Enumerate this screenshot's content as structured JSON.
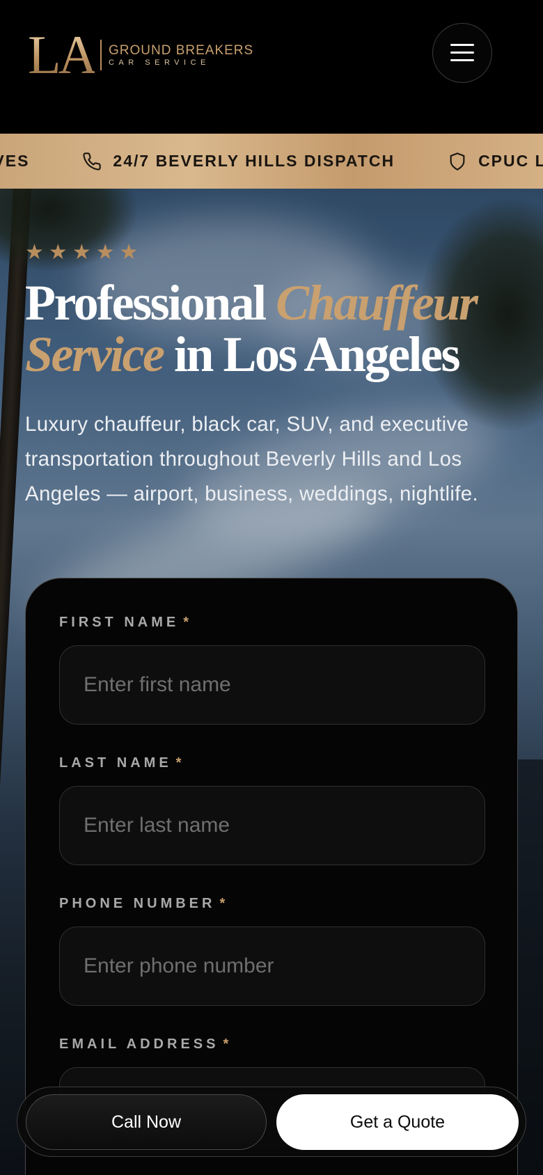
{
  "header": {
    "logo": {
      "mark": "LA",
      "line1": "GROUND BREAKERS",
      "line2": "CAR SERVICE"
    },
    "menu_icon": "hamburger-menu-icon"
  },
  "ticker": {
    "items": [
      {
        "icon": "",
        "label": "IVES"
      },
      {
        "icon": "phone-icon",
        "label": "24/7 BEVERLY HILLS DISPATCH"
      },
      {
        "icon": "shield-icon",
        "label": "CPUC L"
      }
    ]
  },
  "hero": {
    "rating_stars": 5,
    "headline": {
      "part1": "Professional ",
      "accent1": "Chauffeur",
      "accent2": "Service",
      "part2": " in Los Angeles"
    },
    "subtext": "Luxury chauffeur, black car, SUV, and executive transportation throughout Beverly Hills and Los Angeles — airport, business, weddings, nightlife."
  },
  "form": {
    "required_marker": "*",
    "fields": [
      {
        "label": "FIRST NAME",
        "placeholder": "Enter first name",
        "value": ""
      },
      {
        "label": "LAST NAME",
        "placeholder": "Enter last name",
        "value": ""
      },
      {
        "label": "PHONE NUMBER",
        "placeholder": "Enter phone number",
        "value": ""
      },
      {
        "label": "EMAIL ADDRESS",
        "placeholder": "",
        "value": ""
      }
    ]
  },
  "actions": {
    "call_label": "Call Now",
    "quote_label": "Get a Quote"
  },
  "colors": {
    "accent_gold": "#c9a06f",
    "ticker_gold": "#d4b085",
    "background": "#000000"
  }
}
